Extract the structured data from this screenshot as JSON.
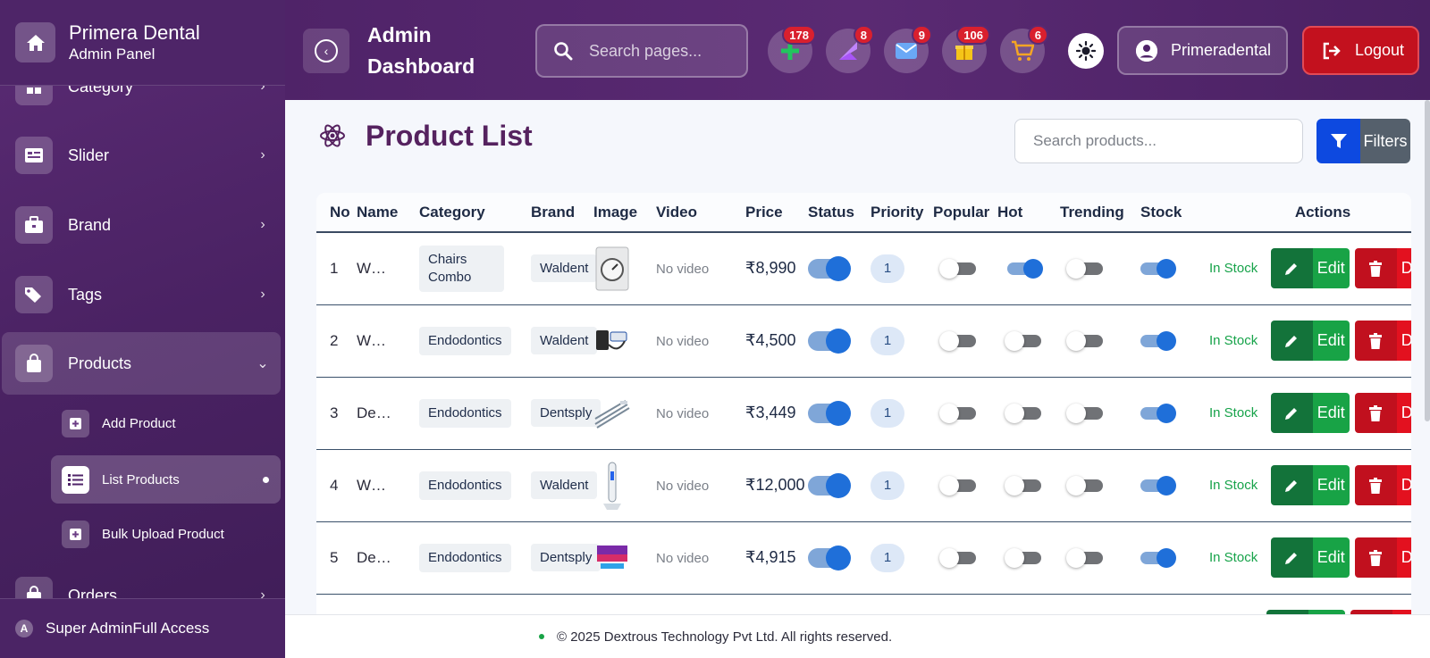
{
  "sidebar": {
    "brand_title": "Primera Dental",
    "brand_subtitle": "Admin Panel",
    "items": [
      {
        "label": "Category",
        "icon": "category-icon"
      },
      {
        "label": "Slider",
        "icon": "slider-icon"
      },
      {
        "label": "Brand",
        "icon": "briefcase-icon"
      },
      {
        "label": "Tags",
        "icon": "tags-icon"
      },
      {
        "label": "Products",
        "icon": "shopping-bag-icon"
      },
      {
        "label": "Orders",
        "icon": "orders-icon"
      }
    ],
    "sub_items": [
      {
        "label": "Add Product",
        "icon": "add-square-icon"
      },
      {
        "label": "List Products",
        "icon": "list-icon"
      },
      {
        "label": "Bulk Upload Product",
        "icon": "add-square-icon"
      }
    ],
    "footer_badge": "A",
    "footer_text": "Super AdminFull Access"
  },
  "header": {
    "title": "Admin Dashboard",
    "search_placeholder": "Search pages...",
    "badges": {
      "plus": "178",
      "leads": "8",
      "mail": "9",
      "gifts": "106",
      "cart": "6"
    },
    "user_name": "Primeradental",
    "logout_label": "Logout"
  },
  "main": {
    "title": "Product List",
    "search_placeholder": "Search products...",
    "filters_label": "Filters",
    "columns": [
      "No",
      "Name",
      "Category",
      "Brand",
      "Image",
      "Video",
      "Price",
      "Status",
      "Priority",
      "Popular",
      "Hot",
      "Trending",
      "Stock",
      "Actions"
    ],
    "rows": [
      {
        "no": "1",
        "name": "W…",
        "category": "Chairs Combo",
        "brand": "Waldent",
        "video": "No video",
        "price": "₹8,990",
        "priority": "1",
        "stock": "In Stock",
        "edit": "Edit",
        "delete": "Delete"
      },
      {
        "no": "2",
        "name": "W…",
        "category": "Endodontics",
        "brand": "Waldent",
        "video": "No video",
        "price": "₹4,500",
        "priority": "1",
        "stock": "In Stock",
        "edit": "Edit",
        "delete": "Delete"
      },
      {
        "no": "3",
        "name": "De…",
        "category": "Endodontics",
        "brand": "Dentsply",
        "video": "No video",
        "price": "₹3,449",
        "priority": "1",
        "stock": "In Stock",
        "edit": "Edit",
        "delete": "Delete"
      },
      {
        "no": "4",
        "name": "W…",
        "category": "Endodontics",
        "brand": "Waldent",
        "video": "No video",
        "price": "₹12,000",
        "priority": "1",
        "stock": "In Stock",
        "edit": "Edit",
        "delete": "Delete"
      },
      {
        "no": "5",
        "name": "De…",
        "category": "Endodontics",
        "brand": "Dentsply",
        "video": "No video",
        "price": "₹4,915",
        "priority": "1",
        "stock": "In Stock",
        "edit": "Edit",
        "delete": "Delete"
      }
    ]
  },
  "footer": {
    "text": "© 2025 Dextrous Technology Pvt Ltd. All rights reserved."
  }
}
